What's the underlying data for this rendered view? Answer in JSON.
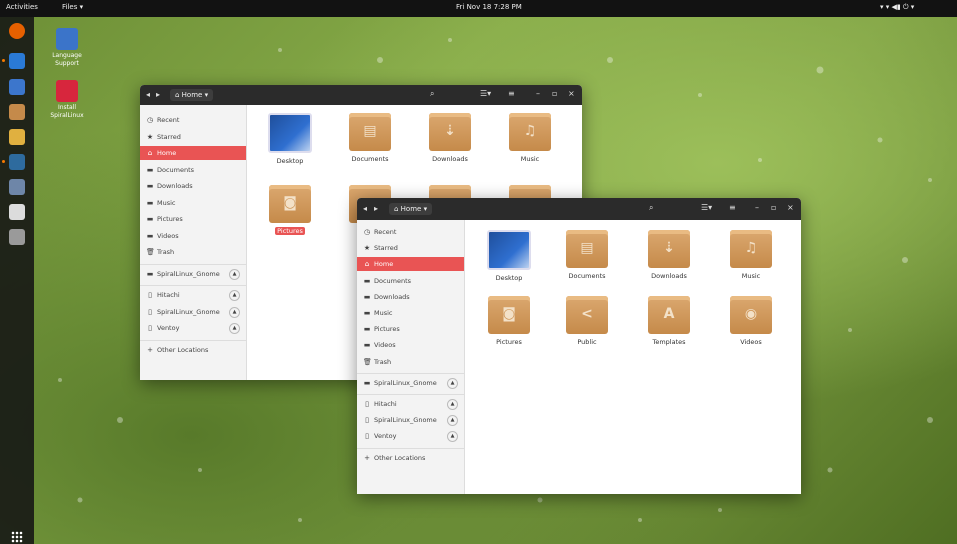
{
  "topbar": {
    "activities": "Activities",
    "app_menu": "Files ▾",
    "clock": "Fri Nov 18  7:28 PM",
    "status": "▾   ▾ ◀▮ ⏻ ▾"
  },
  "desktop_icons": [
    {
      "label_line1": "Language",
      "label_line2": "Support",
      "color": "#3b74c9"
    },
    {
      "label_line1": "Install",
      "label_line2": "SpiralLinux",
      "color": "#d7263d"
    }
  ],
  "dock_colors": [
    "#e66000",
    "#2a7ad6",
    "#3c76cc",
    "#c58a4a",
    "#e0b040",
    "#2e6b9e",
    "#6e86a8",
    "#dcdcdc",
    "#9a9a9a"
  ],
  "window_back": {
    "path_label": "Home",
    "sidebar": [
      {
        "icon": "◷",
        "label": "Recent"
      },
      {
        "icon": "★",
        "label": "Starred"
      },
      {
        "icon": "⌂",
        "label": "Home"
      },
      {
        "icon": "▬",
        "label": "Documents"
      },
      {
        "icon": "▬",
        "label": "Downloads"
      },
      {
        "icon": "▬",
        "label": "Music"
      },
      {
        "icon": "▬",
        "label": "Pictures"
      },
      {
        "icon": "▬",
        "label": "Videos"
      },
      {
        "icon": "🗑",
        "label": "Trash"
      },
      {
        "icon": "▬",
        "label": "SpiralLinux_Gnome"
      },
      {
        "icon": "▯",
        "label": "Hitachi"
      },
      {
        "icon": "▯",
        "label": "SpiralLinux_Gnome"
      },
      {
        "icon": "▯",
        "label": "Ventoy"
      },
      {
        "icon": "+",
        "label": "Other Locations"
      }
    ],
    "folders": [
      "Desktop",
      "Documents",
      "Downloads",
      "Music",
      "Pictures"
    ]
  },
  "window_front": {
    "path_label": "Home",
    "sidebar": [
      {
        "icon": "◷",
        "label": "Recent"
      },
      {
        "icon": "★",
        "label": "Starred"
      },
      {
        "icon": "⌂",
        "label": "Home"
      },
      {
        "icon": "▬",
        "label": "Documents"
      },
      {
        "icon": "▬",
        "label": "Downloads"
      },
      {
        "icon": "▬",
        "label": "Music"
      },
      {
        "icon": "▬",
        "label": "Pictures"
      },
      {
        "icon": "▬",
        "label": "Videos"
      },
      {
        "icon": "🗑",
        "label": "Trash"
      },
      {
        "icon": "▬",
        "label": "SpiralLinux_Gnome"
      },
      {
        "icon": "▯",
        "label": "Hitachi"
      },
      {
        "icon": "▯",
        "label": "SpiralLinux_Gnome"
      },
      {
        "icon": "▯",
        "label": "Ventoy"
      },
      {
        "icon": "+",
        "label": "Other Locations"
      }
    ],
    "folders": [
      {
        "label": "Desktop",
        "glyph": ""
      },
      {
        "label": "Documents",
        "glyph": "▤"
      },
      {
        "label": "Downloads",
        "glyph": "⇣"
      },
      {
        "label": "Music",
        "glyph": "♫"
      },
      {
        "label": "Pictures",
        "glyph": "◙"
      },
      {
        "label": "Public",
        "glyph": "<"
      },
      {
        "label": "Templates",
        "glyph": "A"
      },
      {
        "label": "Videos",
        "glyph": "◉"
      }
    ]
  },
  "eject_glyph": "▲",
  "colors": {
    "accent": "#e95454",
    "folder": "#d29a5c",
    "titlebar": "#2b2b2b"
  }
}
